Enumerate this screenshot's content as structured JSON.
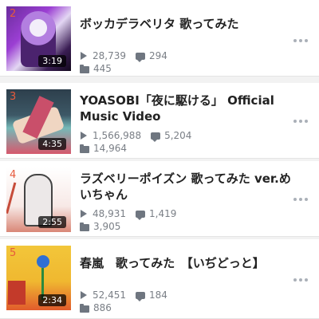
{
  "videos": [
    {
      "rank": "2",
      "duration": "3:19",
      "title": "ボッカデラベリタ 歌ってみた",
      "views": "28,739",
      "comments": "294",
      "mylists": "445"
    },
    {
      "rank": "3",
      "duration": "4:35",
      "title": "YOASOBI「夜に駆ける」 Official Music Video",
      "views": "1,566,988",
      "comments": "5,204",
      "mylists": "14,964"
    },
    {
      "rank": "4",
      "duration": "2:55",
      "title": "ラズベリーポイズン 歌ってみた ver.めいちゃん",
      "views": "48,931",
      "comments": "1,419",
      "mylists": "3,905"
    },
    {
      "rank": "5",
      "duration": "2:34",
      "title": "春嵐　歌ってみた　【いぢどっと】",
      "views": "52,451",
      "comments": "184",
      "mylists": "886"
    }
  ],
  "icons": {
    "views": "play-icon",
    "comments": "comment-icon",
    "mylists": "folder-icon",
    "menu": "more-dots-icon"
  },
  "colors": {
    "rank": "#e65a3c",
    "stats": "#7a7f86",
    "background": "#f2f2f2"
  }
}
